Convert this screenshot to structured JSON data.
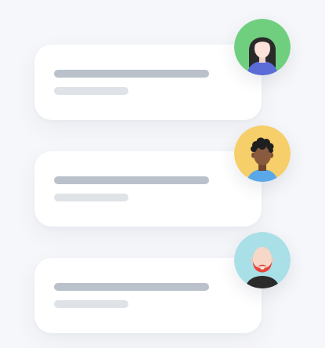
{
  "cards": [
    {
      "avatar": {
        "icon": "woman-avatar-icon",
        "background_color": "#6fcf7f",
        "hair_color": "#2a2a2a",
        "skin_color": "#fbe3dc",
        "shirt_color": "#5b6bd8"
      }
    },
    {
      "avatar": {
        "icon": "man-curly-hair-avatar-icon",
        "background_color": "#f6cf6a",
        "hair_color": "#1f1f1f",
        "skin_color": "#8a5a3e",
        "shirt_color": "#5aa8e8"
      }
    },
    {
      "avatar": {
        "icon": "bald-bearded-man-avatar-icon",
        "background_color": "#a9dfe6",
        "beard_color": "#e8453a",
        "skin_color": "#f6d7c8",
        "shirt_color": "#2b2b2b"
      }
    }
  ],
  "colors": {
    "page_background": "#f6f7fa",
    "card_background": "#ffffff",
    "primary_line": "#bac1cb",
    "secondary_line": "#dfe2e7"
  }
}
